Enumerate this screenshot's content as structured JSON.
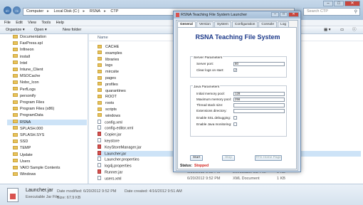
{
  "explorer": {
    "address": [
      "Computer",
      "Local Disk (C:)",
      "RSNA",
      "CTP"
    ],
    "search_placeholder": "Search CTP",
    "menu": [
      "File",
      "Edit",
      "View",
      "Tools",
      "Help"
    ],
    "toolbar": {
      "organize": "Organize ▾",
      "open": "Open ▾",
      "new_folder": "New folder"
    },
    "column_header": "Name",
    "nav_items": [
      "Documentation",
      "FaxPress.spl",
      "Infineon",
      "install",
      "Intel",
      "Intune_Client",
      "MSOCache",
      "Nobo_Icon",
      "PerfLogs",
      "personify",
      "Program Files",
      "Program Files (x86)",
      "ProgramData",
      "RSNA",
      "SPLASH.000",
      "SPLASH.SYS",
      "SSD",
      "TEMP",
      "Update",
      "Users",
      "VAIO Sample Contents",
      "Windows"
    ],
    "selected_nav": "RSNA",
    "files": [
      {
        "name": "CACHE",
        "kind": "folder"
      },
      {
        "name": "examples",
        "kind": "folder"
      },
      {
        "name": "libraries",
        "kind": "folder"
      },
      {
        "name": "logs",
        "kind": "folder"
      },
      {
        "name": "mircsite",
        "kind": "folder"
      },
      {
        "name": "pages",
        "kind": "folder"
      },
      {
        "name": "profiles",
        "kind": "folder"
      },
      {
        "name": "quarantines",
        "kind": "folder"
      },
      {
        "name": "ROOT",
        "kind": "folder"
      },
      {
        "name": "roots",
        "kind": "folder"
      },
      {
        "name": "scripts",
        "kind": "folder"
      },
      {
        "name": "windows",
        "kind": "folder"
      },
      {
        "name": "config.xml",
        "kind": "file"
      },
      {
        "name": "config-editor.xml",
        "kind": "file"
      },
      {
        "name": "Copier.jar",
        "kind": "jar"
      },
      {
        "name": "keystore",
        "kind": "file"
      },
      {
        "name": "KeyStoreManager.jar",
        "kind": "jar"
      },
      {
        "name": "Launcher.jar",
        "kind": "jar",
        "selected": true
      },
      {
        "name": "Launcher.properties",
        "kind": "file"
      },
      {
        "name": "log4j.properties",
        "kind": "file"
      },
      {
        "name": "Runner.jar",
        "kind": "jar",
        "date": "6/20/2012 9:52 PM",
        "type": "Executable Jar File",
        "size": "9 KB"
      },
      {
        "name": "users.xml",
        "kind": "file",
        "date": "6/20/2012 9:52 PM",
        "type": "XML Document",
        "size": "1 KB"
      }
    ],
    "details": {
      "name": "Launcher.jar",
      "type": "Executable Jar File",
      "date_modified": "Date modified: 6/20/2012 9:52 PM",
      "date_created": "Date created: 4/16/2012 9:51 AM",
      "size": "Size: 67.9 KB"
    }
  },
  "dialog": {
    "title": "RSNA Teaching File System Launcher",
    "tabs": [
      "General",
      "Version",
      "System",
      "Configuration",
      "Console",
      "Log"
    ],
    "active_tab": "General",
    "heading": "RSNA Teaching File System",
    "server_group": "Server Parameters",
    "server_port_label": "Server port:",
    "server_port_value": "80",
    "clear_logs_label": "Clear logs on start:",
    "clear_logs_checked": "✓",
    "java_group": "Java Parameters",
    "java_rows": [
      {
        "label": "Initial memory pool:",
        "value": "128"
      },
      {
        "label": "Maximum memory pool:",
        "value": "256"
      },
      {
        "label": "Thread stack size:",
        "value": ""
      },
      {
        "label": "Extensions directory:",
        "value": ""
      }
    ],
    "ssl_debug_label": "Enable SSL debugging:",
    "java_mon_label": "Enable Java monitoring:",
    "buttons": {
      "start": "Start",
      "stop": "Stop",
      "home": "TFS Home Page"
    },
    "status_label": "Status:",
    "status_value": "Stopped"
  }
}
